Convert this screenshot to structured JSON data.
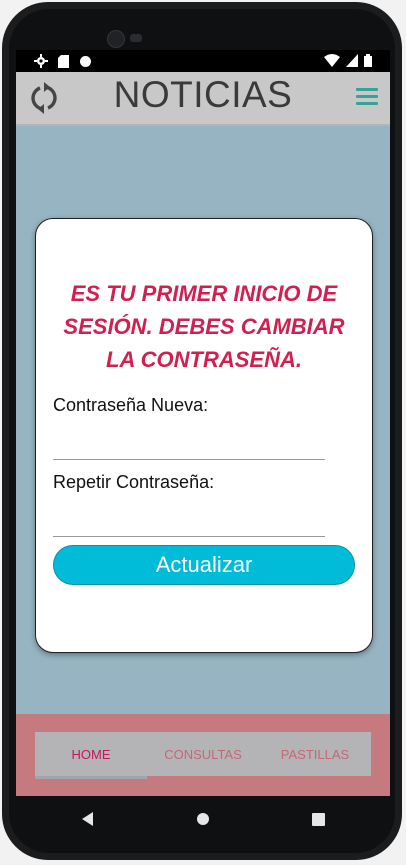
{
  "appbar": {
    "title": "NOTICIAS",
    "refresh_icon": "refresh-icon",
    "menu_icon": "hamburger-menu-icon",
    "accent": "#35a39a"
  },
  "dialog": {
    "heading": "ES TU PRIMER INICIO DE SESIÓN. DEBES CAMBIAR LA CONTRASEÑA.",
    "new_password_label": "Contraseña Nueva:",
    "new_password_value": "",
    "repeat_password_label": "Repetir Contraseña:",
    "repeat_password_value": "",
    "update_button": "Actualizar",
    "heading_color": "#d21f4f",
    "button_color": "#00bcd8"
  },
  "tabs": [
    {
      "label": "HOME",
      "active": true
    },
    {
      "label": "CONSULTAS",
      "active": false
    },
    {
      "label": "PASTILLAS",
      "active": false
    }
  ],
  "statusbar": {
    "icons": [
      "gear-icon",
      "sd-card-icon",
      "circle-icon",
      "wifi-icon",
      "signal-icon",
      "battery-icon"
    ]
  },
  "navbar": {
    "icons": [
      "back-icon",
      "home-icon",
      "recents-icon"
    ]
  }
}
